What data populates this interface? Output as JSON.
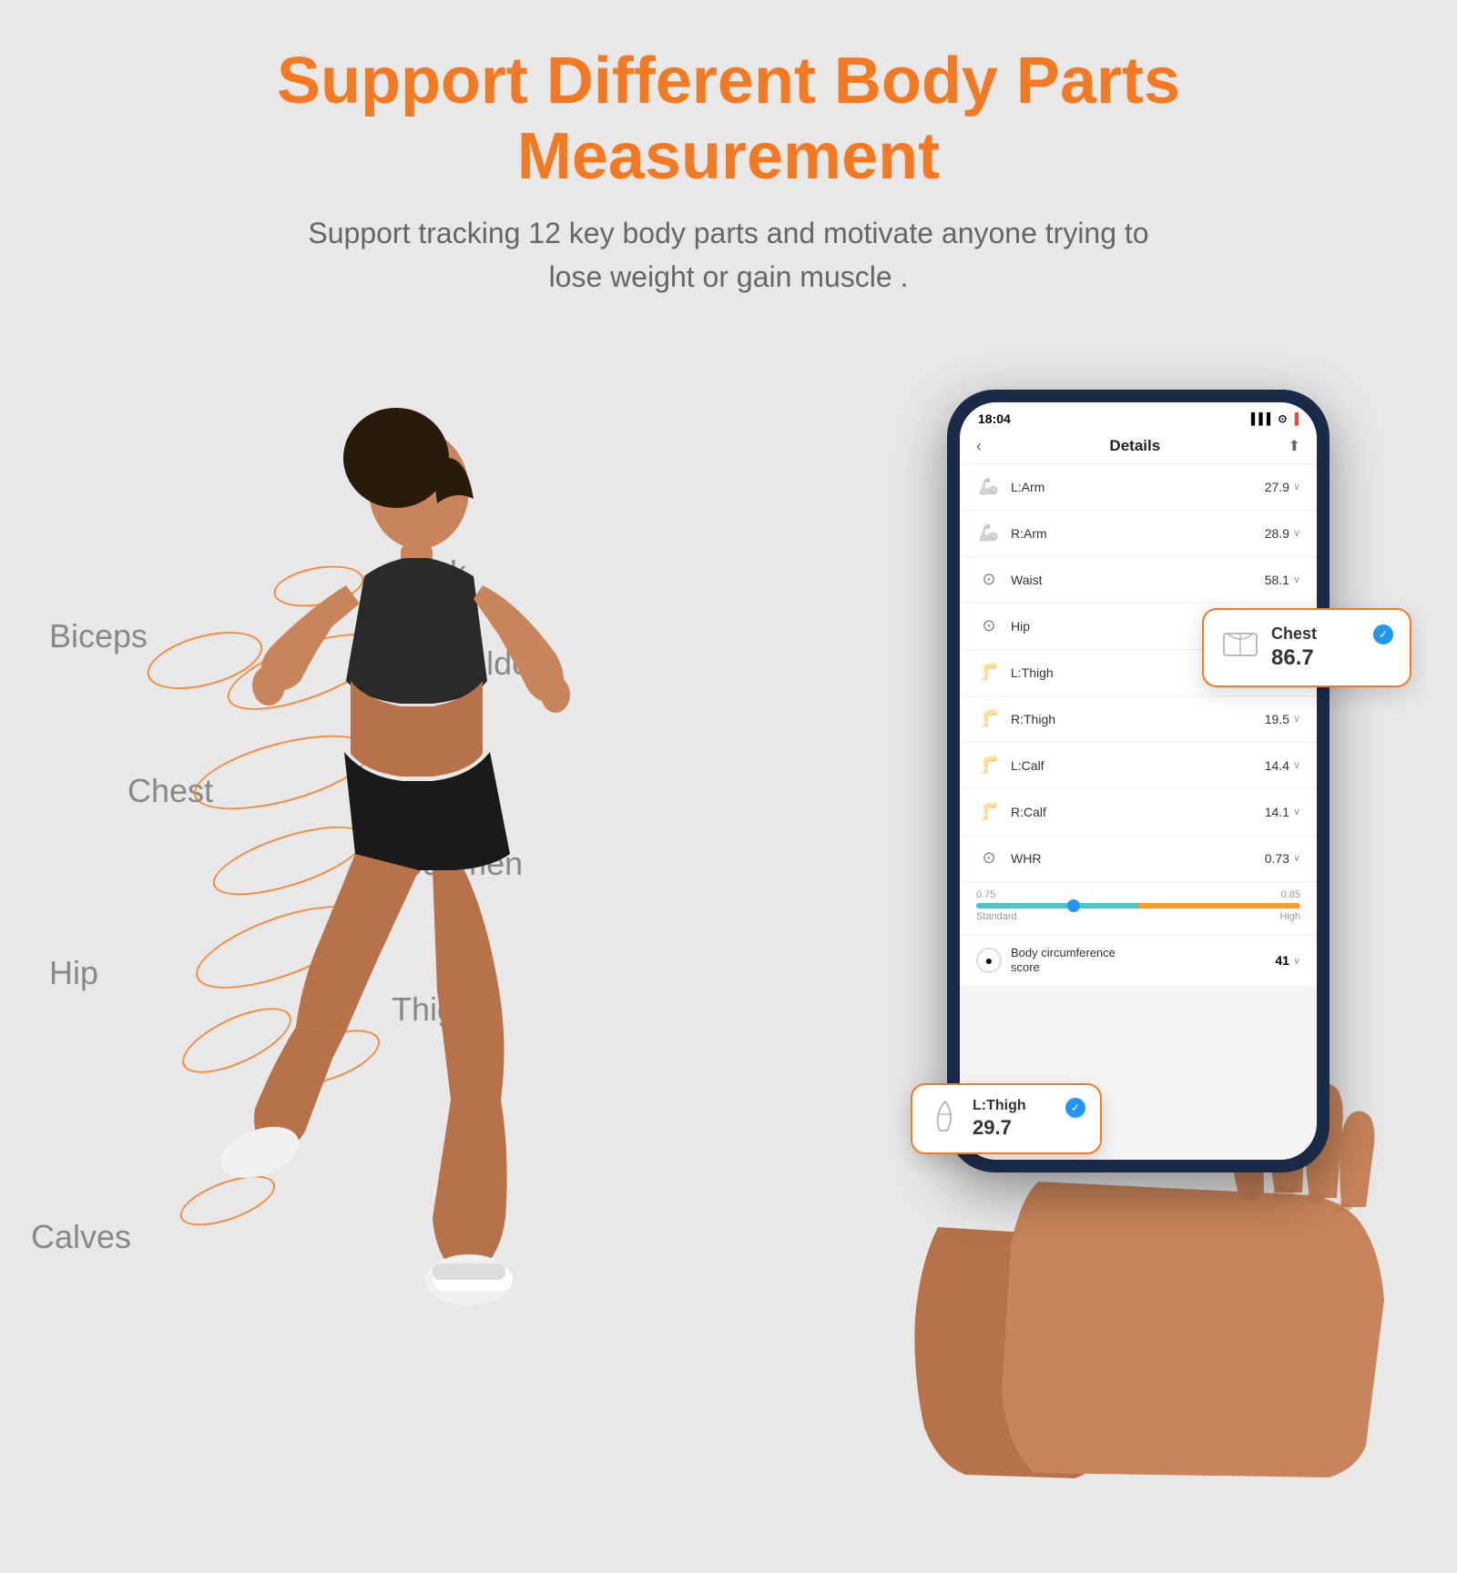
{
  "header": {
    "title": "Support Different Body Parts Measurement",
    "subtitle_line1": "Support tracking 12 key body parts and motivate anyone trying to",
    "subtitle_line2": "lose weight or gain muscle ."
  },
  "body_labels": [
    {
      "id": "biceps",
      "text": "Biceps"
    },
    {
      "id": "neck",
      "text": "Neck"
    },
    {
      "id": "shoulders",
      "text": "Shoulders"
    },
    {
      "id": "chest",
      "text": "Chest"
    },
    {
      "id": "abdomen",
      "text": "Abdomen"
    },
    {
      "id": "hip",
      "text": "Hip"
    },
    {
      "id": "thighs",
      "text": "Thighs"
    },
    {
      "id": "calves",
      "text": "Calves"
    }
  ],
  "phone": {
    "status_time": "18:04",
    "status_signal": "●●●",
    "app_title": "Details",
    "measurements": [
      {
        "icon": "🦾",
        "name": "L:Arm",
        "value": "27.9"
      },
      {
        "icon": "🦾",
        "name": "R:Arm",
        "value": "28.9"
      },
      {
        "icon": "⊙",
        "name": "Waist",
        "value": "58.1"
      },
      {
        "icon": "⊙",
        "name": "Hip",
        "value": ""
      },
      {
        "icon": "🦵",
        "name": "L:Thigh",
        "value": ""
      },
      {
        "icon": "🦵",
        "name": "R:Thigh",
        "value": "19.5"
      },
      {
        "icon": "🦵",
        "name": "L:Calf",
        "value": "14.4"
      },
      {
        "icon": "🦵",
        "name": "R:Calf",
        "value": "14.1"
      },
      {
        "icon": "⊙",
        "name": "WHR",
        "value": "0.73"
      }
    ],
    "whr": {
      "label1": "0.75",
      "label2": "0.85",
      "section1": "Standard",
      "section2": "High"
    },
    "body_score": {
      "label": "Body circumference\nscore",
      "value": "41"
    }
  },
  "popup_chest": {
    "title": "Chest",
    "value": "86.7"
  },
  "popup_lthigh": {
    "title": "L:Thigh",
    "value": "29.7"
  }
}
